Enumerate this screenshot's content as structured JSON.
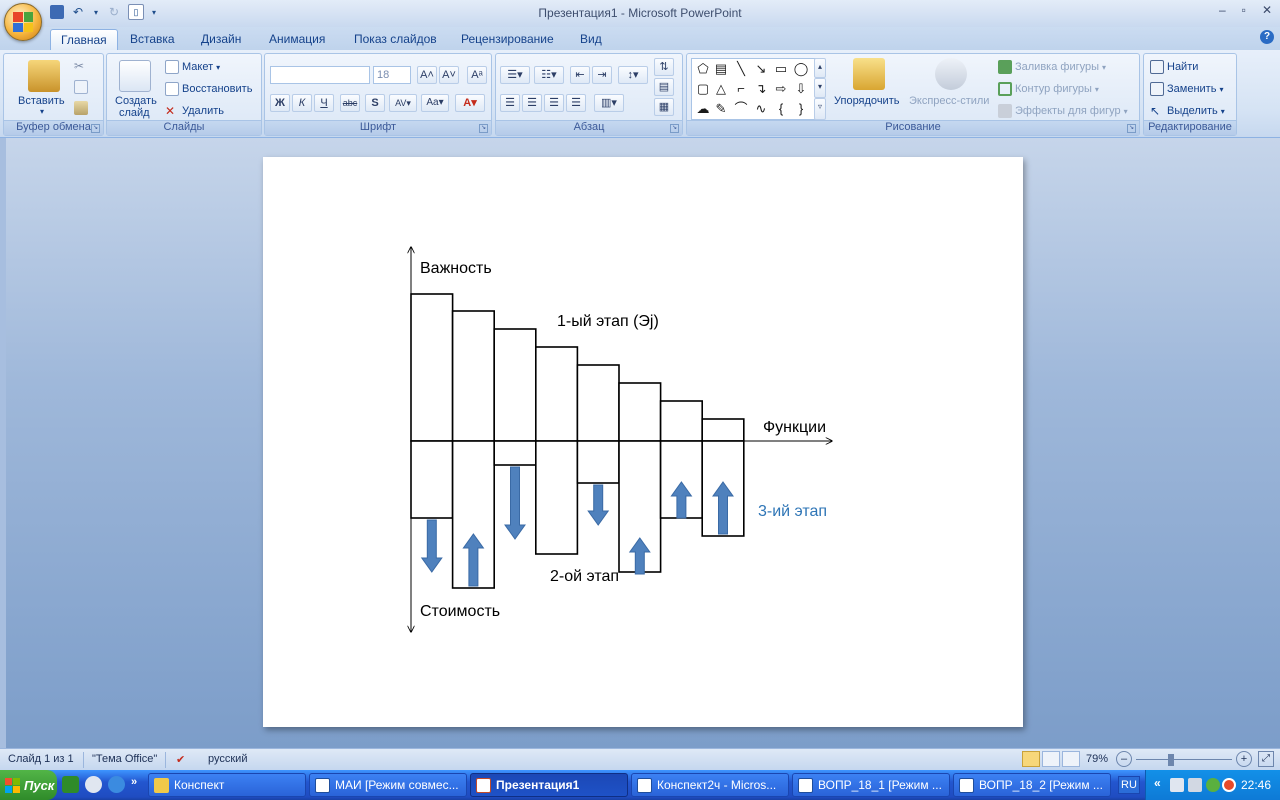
{
  "window": {
    "title": "Презентация1 - Microsoft PowerPoint"
  },
  "tabs": [
    "Главная",
    "Вставка",
    "Дизайн",
    "Анимация",
    "Показ слайдов",
    "Рецензирование",
    "Вид"
  ],
  "ribbon": {
    "clipboard": {
      "label": "Буфер обмена",
      "paste": "Вставить"
    },
    "slides": {
      "label": "Слайды",
      "new_slide_line1": "Создать",
      "new_slide_line2": "слайд",
      "layout": "Макет",
      "reset": "Восстановить",
      "delete": "Удалить"
    },
    "font": {
      "label": "Шрифт",
      "font_name": "",
      "font_size": "18"
    },
    "paragraph": {
      "label": "Абзац"
    },
    "drawing": {
      "label": "Рисование",
      "arrange": "Упорядочить",
      "quick_styles": "Экспресс-стили",
      "shape_fill": "Заливка фигуры",
      "shape_outline": "Контур фигуры",
      "shape_effects": "Эффекты для фигур"
    },
    "editing": {
      "label": "Редактирование",
      "find": "Найти",
      "replace": "Заменить",
      "select": "Выделить"
    }
  },
  "slide": {
    "y_top_label": "Важность",
    "y_bottom_label": "Стоимость",
    "x_label": "Функции",
    "stage1_label": "1-ый этап (Эj)",
    "stage2_label": "2-ой этап",
    "stage3_label": "3-ий этап",
    "colors": {
      "arrow": "#4f81bd",
      "stage3": "#2e75b6"
    },
    "chart_data": {
      "type": "bar",
      "note": "Diverging bar diagram: importance bars above axis, cost bars below axis; arrows show cost adjustment direction",
      "importance": [
        147,
        130,
        112,
        94,
        76,
        58,
        40,
        22
      ],
      "cost_initial": [
        77,
        147,
        24,
        113,
        42,
        131,
        77,
        95
      ],
      "arrows": [
        "down",
        "up",
        "down",
        "none",
        "down",
        "up",
        "up",
        "up"
      ]
    }
  },
  "statusbar": {
    "slide_info": "Слайд 1 из 1",
    "theme": "\"Тема Office\"",
    "language": "русский",
    "zoom": "79%"
  },
  "taskbar": {
    "start": "Пуск",
    "tasks": [
      "Конспект",
      "МАИ [Режим совмес...",
      "Презентация1",
      "Конспект2ч - Micros...",
      "ВОПР_18_1 [Режим ...",
      "ВОПР_18_2 [Режим ..."
    ],
    "lang": "RU",
    "clock": "22:46"
  }
}
